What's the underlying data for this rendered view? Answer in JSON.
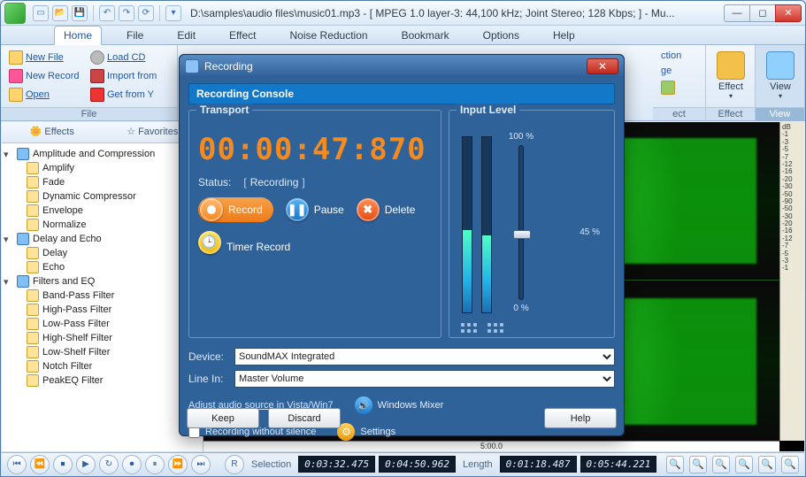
{
  "window": {
    "title": "D:\\samples\\audio files\\music01.mp3 - [ MPEG 1.0 layer-3: 44,100 kHz; Joint Stereo; 128 Kbps;  ] - Mu..."
  },
  "menu": {
    "tabs": [
      "Home",
      "File",
      "Edit",
      "Effect",
      "Noise Reduction",
      "Bookmark",
      "Options",
      "Help"
    ],
    "active": 0
  },
  "ribbon": {
    "file": {
      "label": "File",
      "new_file": "New File",
      "new_record": "New Record",
      "open": "Open",
      "load_cd": "Load CD",
      "import": "Import from",
      "youtube": "Get from Y"
    },
    "right_part": {
      "eff_label": "ect",
      "effect": "Effect",
      "view": "View",
      "view_label": "View",
      "ction": "ction",
      "ge": "ge"
    }
  },
  "side": {
    "tab_effects": "Effects",
    "tab_favorites": "Favorites"
  },
  "tree": {
    "g1": "Amplitude and Compression",
    "g1_items": [
      "Amplify",
      "Fade",
      "Dynamic Compressor",
      "Envelope",
      "Normalize"
    ],
    "g2": "Delay and Echo",
    "g2_items": [
      "Delay",
      "Echo"
    ],
    "g3": "Filters and EQ",
    "g3_items": [
      "Band-Pass Filter",
      "High-Pass Filter",
      "Low-Pass Filter",
      "High-Shelf Filter",
      "Low-Shelf Filter",
      "Notch Filter",
      "PeakEQ Filter"
    ]
  },
  "db_ticks": [
    "dB",
    "-1",
    "-3",
    "-5",
    "-7",
    "-12",
    "-16",
    "-20",
    "-30",
    "-50",
    "-90",
    "-50",
    "-30",
    "-20",
    "-16",
    "-12",
    "-7",
    "-5",
    "-3",
    "-1"
  ],
  "time_label": "5:00.0",
  "status": {
    "selection_label": "Selection",
    "sel_from": "0:03:32.475",
    "sel_to": "0:04:50.962",
    "length_label": "Length",
    "len_a": "0:01:18.487",
    "len_b": "0:05:44.221",
    "r": "R"
  },
  "modal": {
    "title": "Recording",
    "banner": "Recording Console",
    "transport": "Transport",
    "input_level": "Input Level",
    "timer": "00:00:47:870",
    "status_label": "Status:",
    "status_value": "Recording",
    "record": "Record",
    "pause": "Pause",
    "delete": "Delete",
    "timer_record": "Timer Record",
    "device_label": "Device:",
    "device_value": "SoundMAX Integrated",
    "linein_label": "Line In:",
    "linein_value": "Master Volume",
    "adjust_link": "Adjust audio source in Vista/Win7",
    "windows_mixer": "Windows Mixer",
    "rec_without_silence": "Recording without silence",
    "settings": "Settings",
    "slider_top": "100 %",
    "slider_mid": "45 %",
    "slider_bot": "0 %",
    "keep": "Keep",
    "discard": "Discard",
    "help": "Help",
    "meter_left_pct": 47,
    "meter_right_pct": 44,
    "slider_pct": 45
  }
}
